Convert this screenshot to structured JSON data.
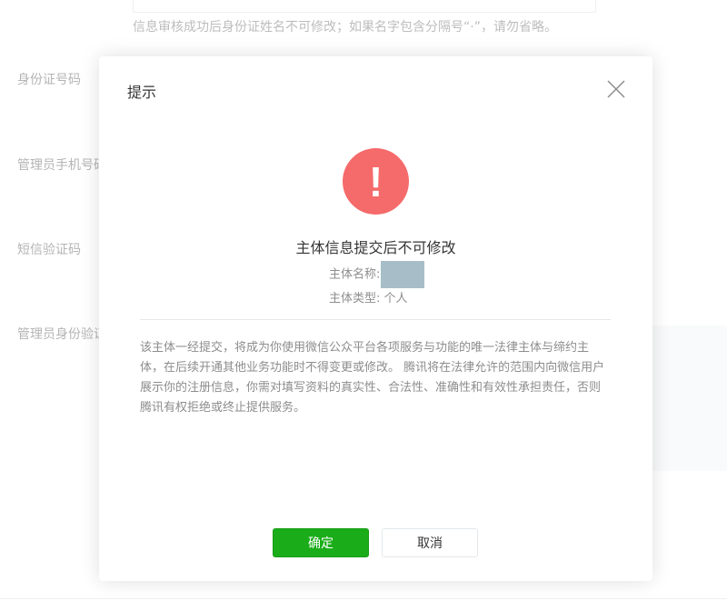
{
  "background_form": {
    "name_hint": "信息审核成功后身份证姓名不可修改；如果名字包含分隔号“·”，请勿省略。",
    "labels": [
      "身份证号码",
      "管理员手机号码",
      "短信验证码",
      "管理员身份验证"
    ]
  },
  "dialog": {
    "title": "提示",
    "close_icon": "close-icon",
    "warning_icon": "exclamation-icon",
    "warning_color": "#f56a6a",
    "headline": "主体信息提交后不可修改",
    "subject_name_label": "主体名称:",
    "subject_type_label": "主体类型:",
    "subject_type_value": "个人",
    "description": "该主体一经提交，将成为你使用微信公众平台各项服务与功能的唯一法律主体与缔约主体，在后续开通其他业务功能时不得变更或修改。 腾讯将在法律允许的范围内向微信用户展示你的注册信息，你需对填写资料的真实性、合法性、准确性和有效性承担责任，否则腾讯有权拒绝或终止提供服务。",
    "confirm_label": "确定",
    "cancel_label": "取消",
    "primary_color": "#1aad19"
  }
}
